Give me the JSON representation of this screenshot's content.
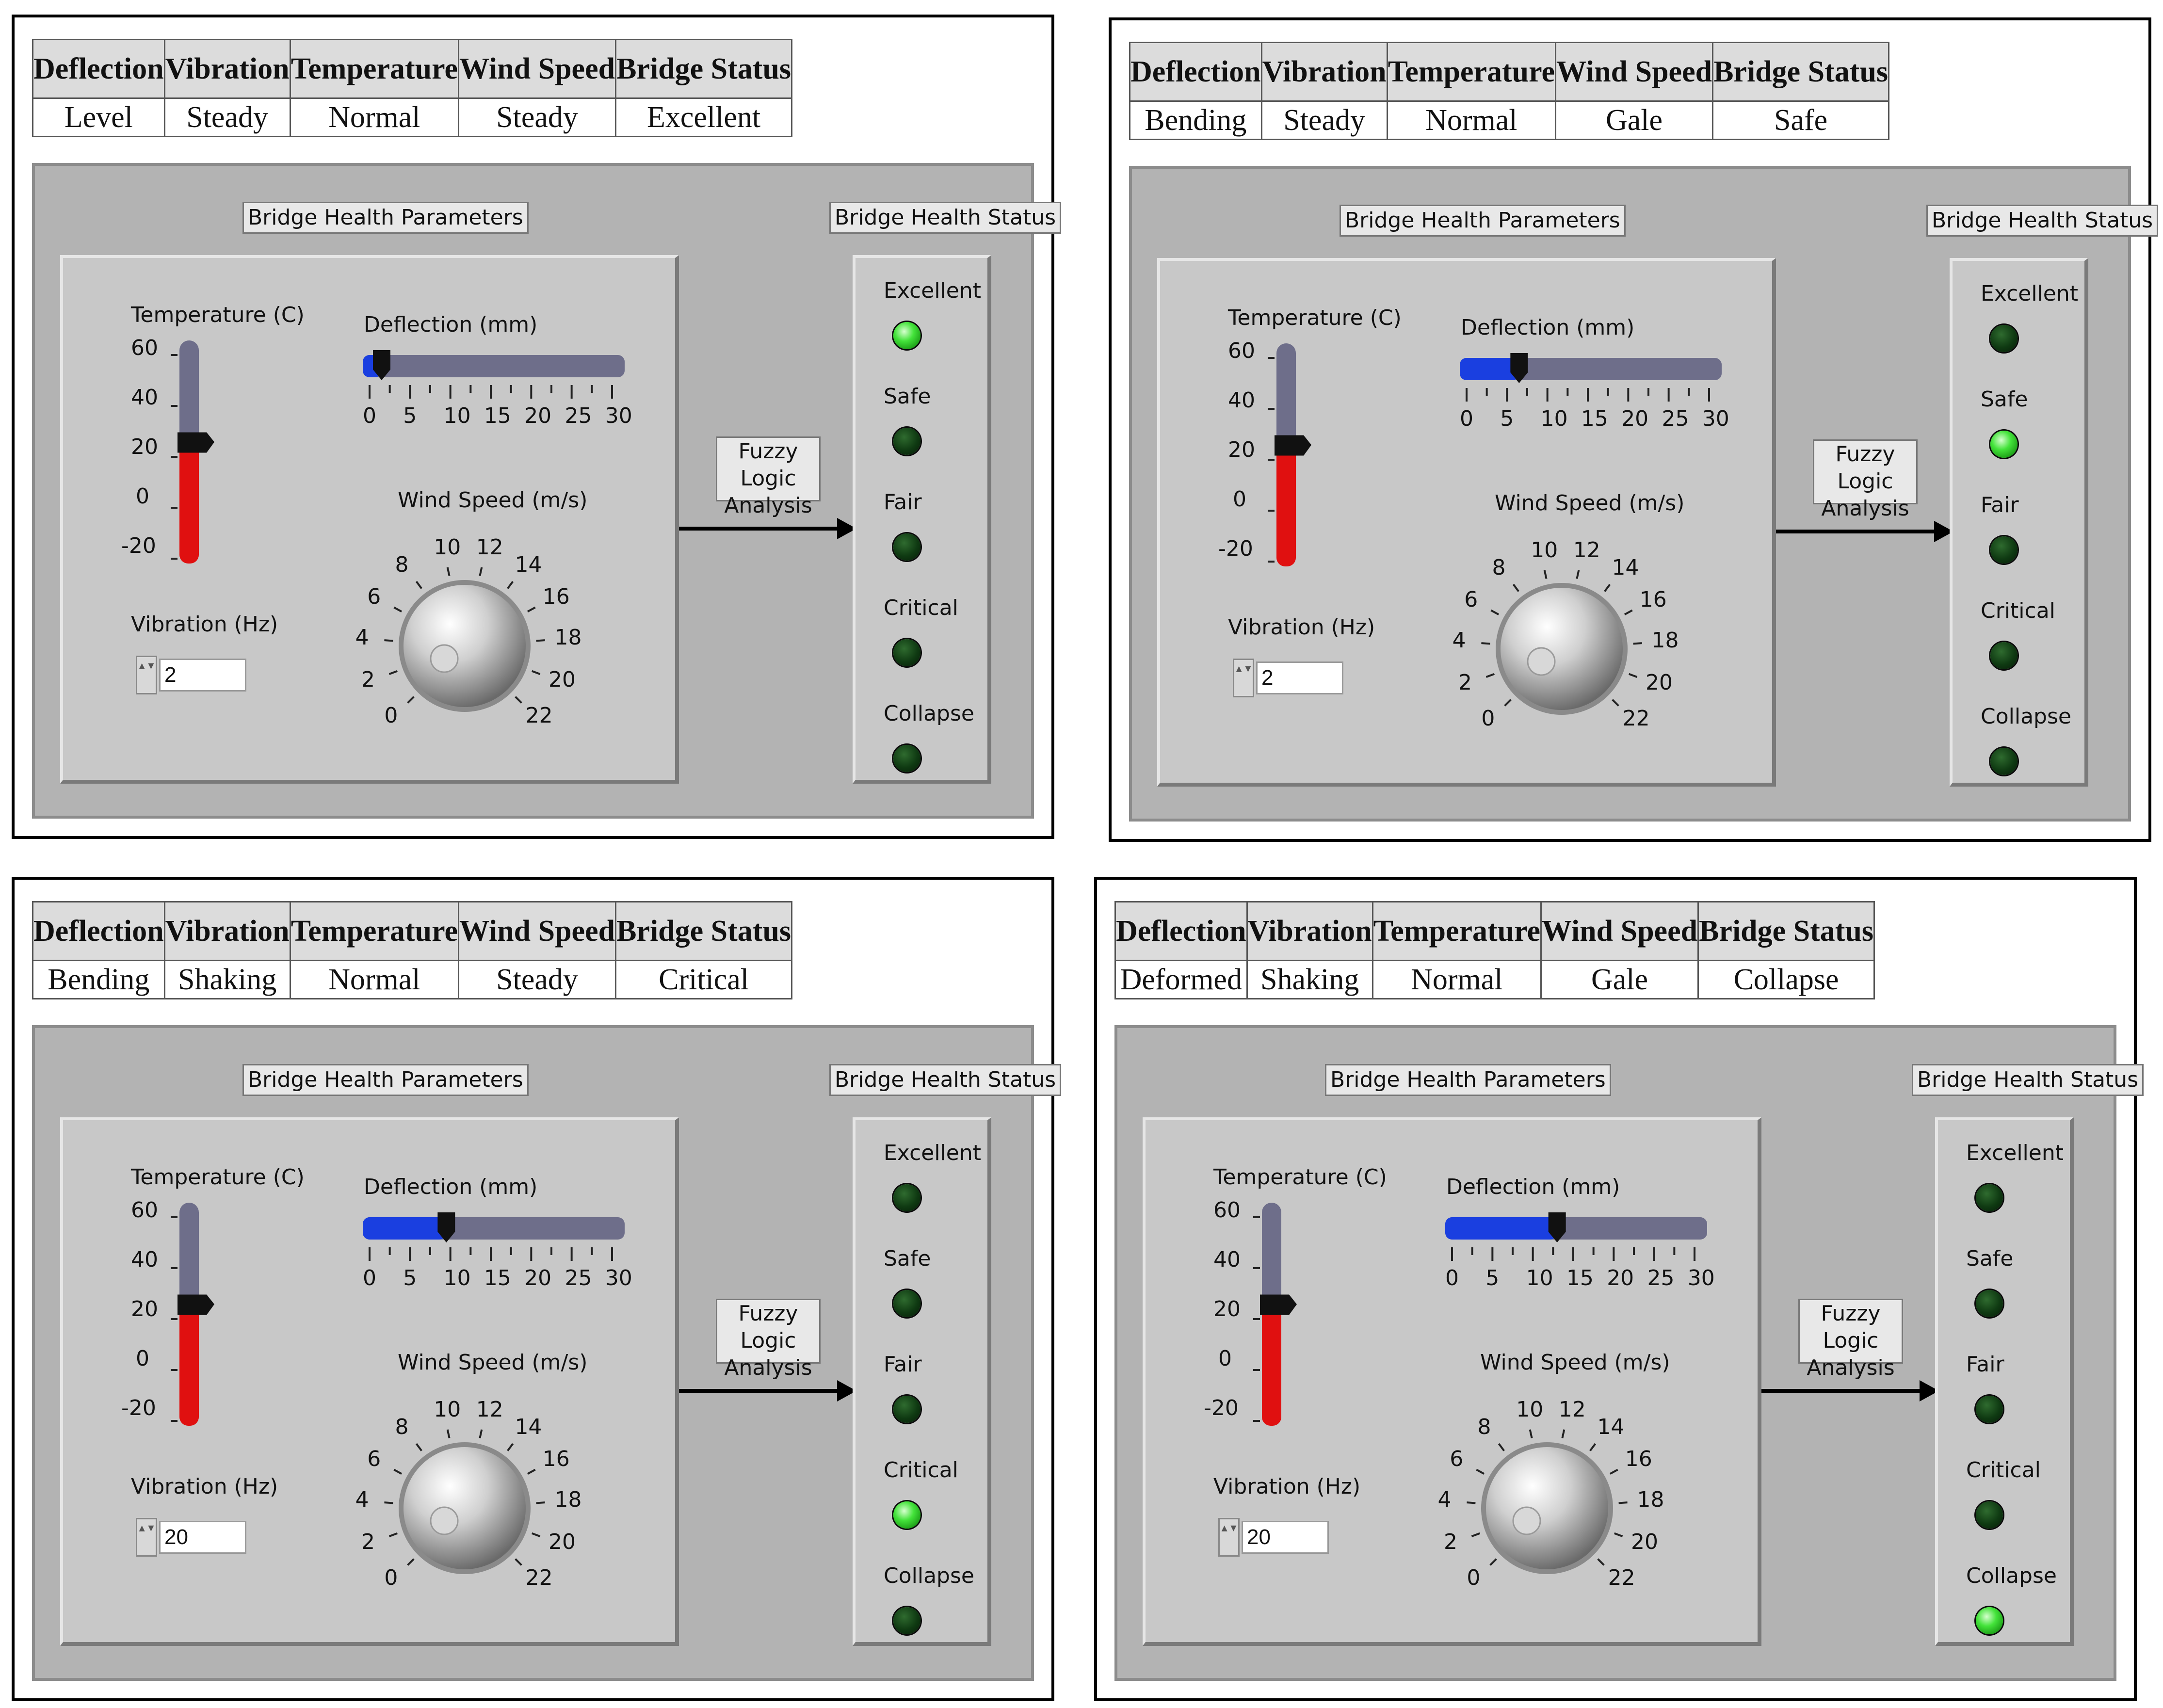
{
  "headers": [
    "Deflection",
    "Vibration",
    "Temperature",
    "Wind Speed",
    "Bridge Status"
  ],
  "params_label": "Bridge Health Parameters",
  "status_label": "Bridge Health Status",
  "fuzzy_label_line1": "Fuzzy Logic",
  "fuzzy_label_line2": "Analysis",
  "temp_label": "Temperature (C)",
  "temp_ticks": [
    "60",
    "40",
    "20",
    "0",
    "-20"
  ],
  "deflection_label": "Deflection (mm)",
  "deflection_ticks": [
    "0",
    "5",
    "10",
    "15",
    "20",
    "25",
    "30"
  ],
  "wind_label": "Wind Speed (m/s)",
  "wind_ticks": [
    "0",
    "2",
    "4",
    "6",
    "8",
    "10",
    "12",
    "14",
    "16",
    "18",
    "20",
    "22"
  ],
  "vibration_label": "Vibration (Hz)",
  "status_names": [
    "Excellent",
    "Safe",
    "Fair",
    "Critical",
    "Collapse"
  ],
  "colors": {
    "led_on": "#43e33a",
    "thermo_fill": "#e01010",
    "slider_fill": "#1a3fe0",
    "track": "#6e6e8a"
  },
  "panels": [
    {
      "row": [
        "Level",
        "Steady",
        "Normal",
        "Steady",
        "Excellent"
      ],
      "temperature": 22,
      "deflection": 1.5,
      "wind_speed": 11,
      "vibration": "2",
      "active_status": 0
    },
    {
      "row": [
        "Bending",
        "Steady",
        "Normal",
        "Gale",
        "Safe"
      ],
      "temperature": 22,
      "deflection": 6.5,
      "wind_speed": 11,
      "vibration": "2",
      "active_status": 1
    },
    {
      "row": [
        "Bending",
        "Shaking",
        "Normal",
        "Steady",
        "Critical"
      ],
      "temperature": 22,
      "deflection": 9.5,
      "wind_speed": 11,
      "vibration": "20",
      "active_status": 3
    },
    {
      "row": [
        "Deformed",
        "Shaking",
        "Normal",
        "Gale",
        "Collapse"
      ],
      "temperature": 22,
      "deflection": 13,
      "wind_speed": 11,
      "vibration": "20",
      "active_status": 4
    }
  ]
}
